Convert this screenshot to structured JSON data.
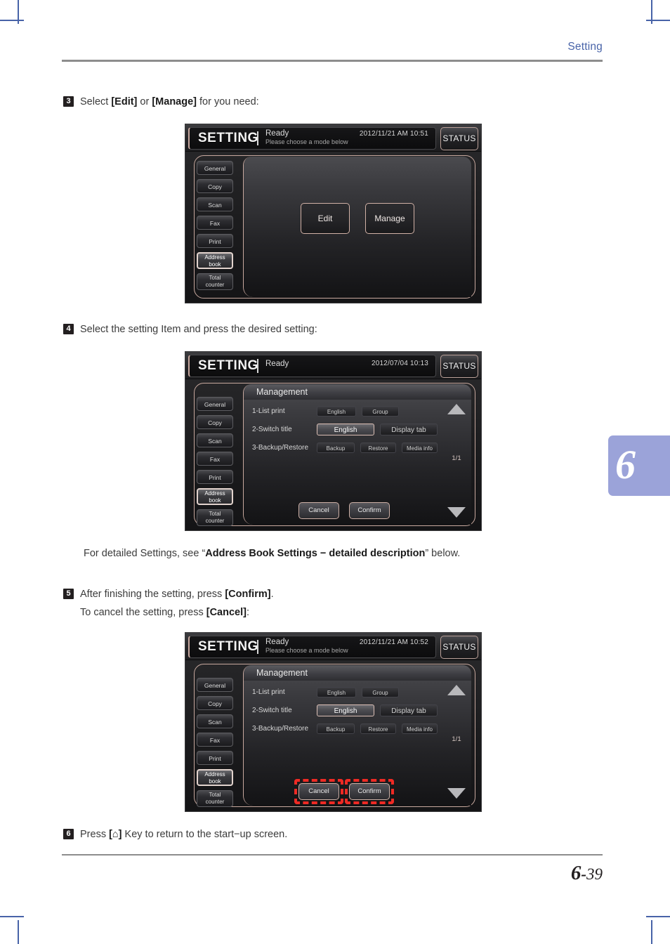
{
  "header": {
    "title": "Setting"
  },
  "footer": {
    "chapter": "6",
    "dash": "-",
    "page": "39"
  },
  "chapter_tab": {
    "number": "6"
  },
  "steps": [
    {
      "num": "3",
      "line1_a": "Select ",
      "line1_b": "[Edit]",
      "line1_c": " or ",
      "line1_d": "[Manage]",
      "line1_e": " for you need:"
    },
    {
      "num": "4",
      "line1_a": "Select the setting Item and press the desired setting:"
    },
    {
      "num": "5",
      "line1_a": "After finishing the setting, press ",
      "line1_b": "[Confirm]",
      "line1_c": ".",
      "line2_a": "To cancel the setting, press ",
      "line2_b": "[Cancel]",
      "line2_c": ":"
    },
    {
      "num": "6",
      "line1_a": "Press ",
      "line1_b": "[⌂]",
      "line1_c": " Key to return to the start−up screen."
    }
  ],
  "note": {
    "prefix": "For detailed Settings, see “",
    "emphasis": "Address Book Settings − detailed description",
    "suffix": "” below."
  },
  "nav_items": [
    {
      "label": "General",
      "two_line": false,
      "selected": false
    },
    {
      "label": "Copy",
      "two_line": false,
      "selected": false
    },
    {
      "label": "Scan",
      "two_line": false,
      "selected": false
    },
    {
      "label": "Fax",
      "two_line": false,
      "selected": false
    },
    {
      "label": "Print",
      "two_line": false,
      "selected": false
    },
    {
      "label_1": "Address",
      "label_2": "book",
      "two_line": true,
      "selected": true
    },
    {
      "label_1": "Total",
      "label_2": "counter",
      "two_line": true,
      "selected": false
    }
  ],
  "screens": {
    "edit_manage": {
      "brand": "SETTING",
      "ready": "Ready",
      "submessage": "Please choose a mode below",
      "datetime": "2012/11/21 AM 10:51",
      "status_button": "STATUS",
      "choice_edit": "Edit",
      "choice_manage": "Manage"
    },
    "management": {
      "brand": "SETTING",
      "ready": "Ready",
      "submessage": "",
      "datetime": "2012/07/04 10:13",
      "status_button": "STATUS",
      "section_title": "Management",
      "rows": [
        {
          "label": "1-List print",
          "options": [
            {
              "text": "English",
              "selected": false,
              "width": "w1"
            },
            {
              "text": "Group",
              "selected": false,
              "width": "w2"
            }
          ]
        },
        {
          "label": "2-Switch title",
          "options": [
            {
              "text": "English",
              "selected": true,
              "width": "wide"
            },
            {
              "text": "Display tab",
              "selected": false,
              "width": "wide"
            }
          ]
        },
        {
          "label": "3-Backup/Restore",
          "options": [
            {
              "text": "Backup",
              "selected": false,
              "width": "w1"
            },
            {
              "text": "Restore",
              "selected": false,
              "width": "w2"
            },
            {
              "text": "Media info",
              "selected": false,
              "width": "w2"
            }
          ]
        }
      ],
      "page_count": "1/1",
      "cancel": "Cancel",
      "confirm": "Confirm"
    },
    "management_highlighted": {
      "brand": "SETTING",
      "ready": "Ready",
      "submessage": "Please choose a mode below",
      "datetime": "2012/11/21 AM 10:52",
      "status_button": "STATUS",
      "section_title": "Management",
      "rows": [
        {
          "label": "1-List print",
          "options": [
            {
              "text": "English",
              "selected": false,
              "width": "w1"
            },
            {
              "text": "Group",
              "selected": false,
              "width": "w2"
            }
          ]
        },
        {
          "label": "2-Switch title",
          "options": [
            {
              "text": "English",
              "selected": true,
              "width": "wide"
            },
            {
              "text": "Display tab",
              "selected": false,
              "width": "wide"
            }
          ]
        },
        {
          "label": "3-Backup/Restore",
          "options": [
            {
              "text": "Backup",
              "selected": false,
              "width": "w1"
            },
            {
              "text": "Restore",
              "selected": false,
              "width": "w2"
            },
            {
              "text": "Media info",
              "selected": false,
              "width": "w2"
            }
          ]
        }
      ],
      "page_count": "1/1",
      "cancel": "Cancel",
      "confirm": "Confirm"
    }
  },
  "colors": {
    "accent_blue": "#4863a8",
    "rule_gray": "#8d8d8d",
    "tab_purple": "#9ba3d9",
    "highlight_red": "#ee2a24"
  }
}
